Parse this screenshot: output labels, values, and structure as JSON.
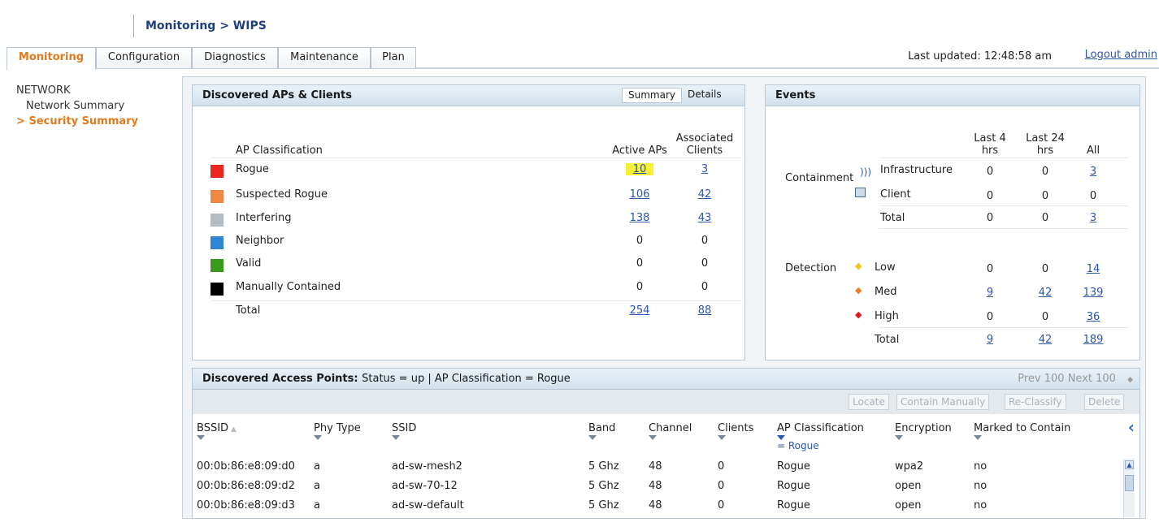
{
  "header": {
    "breadcrumb": "Monitoring > WIPS"
  },
  "tabs": [
    "Monitoring",
    "Configuration",
    "Diagnostics",
    "Maintenance",
    "Plan"
  ],
  "topbar": {
    "last_updated": "Last updated: 12:48:58 am",
    "logout": "Logout admin"
  },
  "sidebar": {
    "section": "NETWORK",
    "items": [
      {
        "label": "Network Summary"
      },
      {
        "label": "Security Summary",
        "marker": ">"
      }
    ]
  },
  "ap_panel": {
    "title": "Discovered APs & Clients",
    "toggles": [
      "Summary",
      "Details"
    ],
    "col_classification": "AP Classification",
    "col_active": "Active APs",
    "col_clients_1": "Associated",
    "col_clients_2": "Clients",
    "rows": [
      {
        "label": "Rogue",
        "color": "#e8281e",
        "active": "10",
        "clients": "3"
      },
      {
        "label": "Suspected Rogue",
        "color": "#ef8844",
        "active": "106",
        "clients": "42"
      },
      {
        "label": "Interfering",
        "color": "#b5bcc1",
        "active": "138",
        "clients": "43"
      },
      {
        "label": "Neighbor",
        "color": "#2e86d2",
        "active": "0",
        "clients": "0"
      },
      {
        "label": "Valid",
        "color": "#3a9a1d",
        "active": "0",
        "clients": "0"
      },
      {
        "label": "Manually Contained",
        "color": "#000000",
        "active": "0",
        "clients": "0"
      }
    ],
    "total": {
      "label": "Total",
      "active": "254",
      "clients": "88"
    }
  },
  "events_panel": {
    "title": "Events",
    "col_last4_1": "Last 4",
    "col_last4_2": "hrs",
    "col_last24_1": "Last 24",
    "col_last24_2": "hrs",
    "col_all": "All",
    "containment_label": "Containment",
    "containment_rows": [
      {
        "label": "Infrastructure",
        "l4": "0",
        "l24": "0",
        "all": "3"
      },
      {
        "label": "Client",
        "l4": "0",
        "l24": "0",
        "all": "0"
      },
      {
        "label": "Total",
        "l4": "0",
        "l24": "0",
        "all": "3"
      }
    ],
    "detection_label": "Detection",
    "detection_rows": [
      {
        "label": "Low",
        "color": "#f2c40f",
        "l4": "0",
        "l24": "0",
        "all": "14"
      },
      {
        "label": "Med",
        "color": "#ea7f26",
        "l4": "9",
        "l24": "42",
        "all": "139"
      },
      {
        "label": "High",
        "color": "#e01b1b",
        "l4": "0",
        "l24": "0",
        "all": "36"
      },
      {
        "label": "Total",
        "l4": "9",
        "l24": "42",
        "all": "189"
      }
    ]
  },
  "dap_panel": {
    "title": "Discovered Access Points:",
    "filter": "Status = up | AP Classification = Rogue",
    "pager": "Prev 100  Next 100",
    "pager_icon": "◆",
    "buttons": [
      "Locate",
      "Contain Manually",
      "Re-Classify",
      "Delete"
    ],
    "columns": [
      "BSSID",
      "Phy Type",
      "SSID",
      "Band",
      "Channel",
      "Clients",
      "AP Classification",
      "Encryption",
      "Marked to Contain"
    ],
    "active_filter": "= Rogue",
    "rows": [
      [
        "00:0b:86:e8:09:d0",
        "a",
        "ad-sw-mesh2",
        "5 Ghz",
        "48",
        "0",
        "Rogue",
        "wpa2",
        "no"
      ],
      [
        "00:0b:86:e8:09:d2",
        "a",
        "ad-sw-70-12",
        "5 Ghz",
        "48",
        "0",
        "Rogue",
        "open",
        "no"
      ],
      [
        "00:0b:86:e8:09:d3",
        "a",
        "ad-sw-default",
        "5 Ghz",
        "48",
        "0",
        "Rogue",
        "open",
        "no"
      ]
    ]
  }
}
